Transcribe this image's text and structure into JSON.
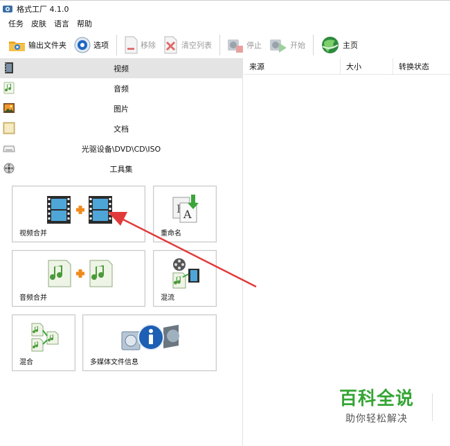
{
  "window": {
    "title": "格式工厂 4.1.0"
  },
  "menu": [
    "任务",
    "皮肤",
    "语言",
    "帮助"
  ],
  "toolbar": {
    "output_folder": "输出文件夹",
    "options": "选项",
    "remove": "移除",
    "clear_list": "清空列表",
    "stop": "停止",
    "start": "开始",
    "home": "主页"
  },
  "categories": [
    {
      "label": "视频",
      "icon": "film-icon",
      "active": true
    },
    {
      "label": "音频",
      "icon": "music-note-icon"
    },
    {
      "label": "图片",
      "icon": "picture-icon"
    },
    {
      "label": "文档",
      "icon": "document-icon"
    },
    {
      "label": "光驱设备\\DVD\\CD\\ISO",
      "icon": "disc-drive-icon"
    },
    {
      "label": "工具集",
      "icon": "tools-icon"
    }
  ],
  "tiles": {
    "video_merge": "视频合并",
    "rename": "重命名",
    "audio_merge": "音频合并",
    "mux": "混流",
    "mix": "混合",
    "media_info": "多媒体文件信息"
  },
  "table": {
    "columns": [
      "来源",
      "大小",
      "转换状态"
    ]
  },
  "watermark": {
    "title": "百科全说",
    "subtitle": "助你轻松解决"
  },
  "colors": {
    "arrow": "#e23a3a",
    "watermark_green": "#35a535",
    "active_category_bg": "#e4e4e4"
  }
}
